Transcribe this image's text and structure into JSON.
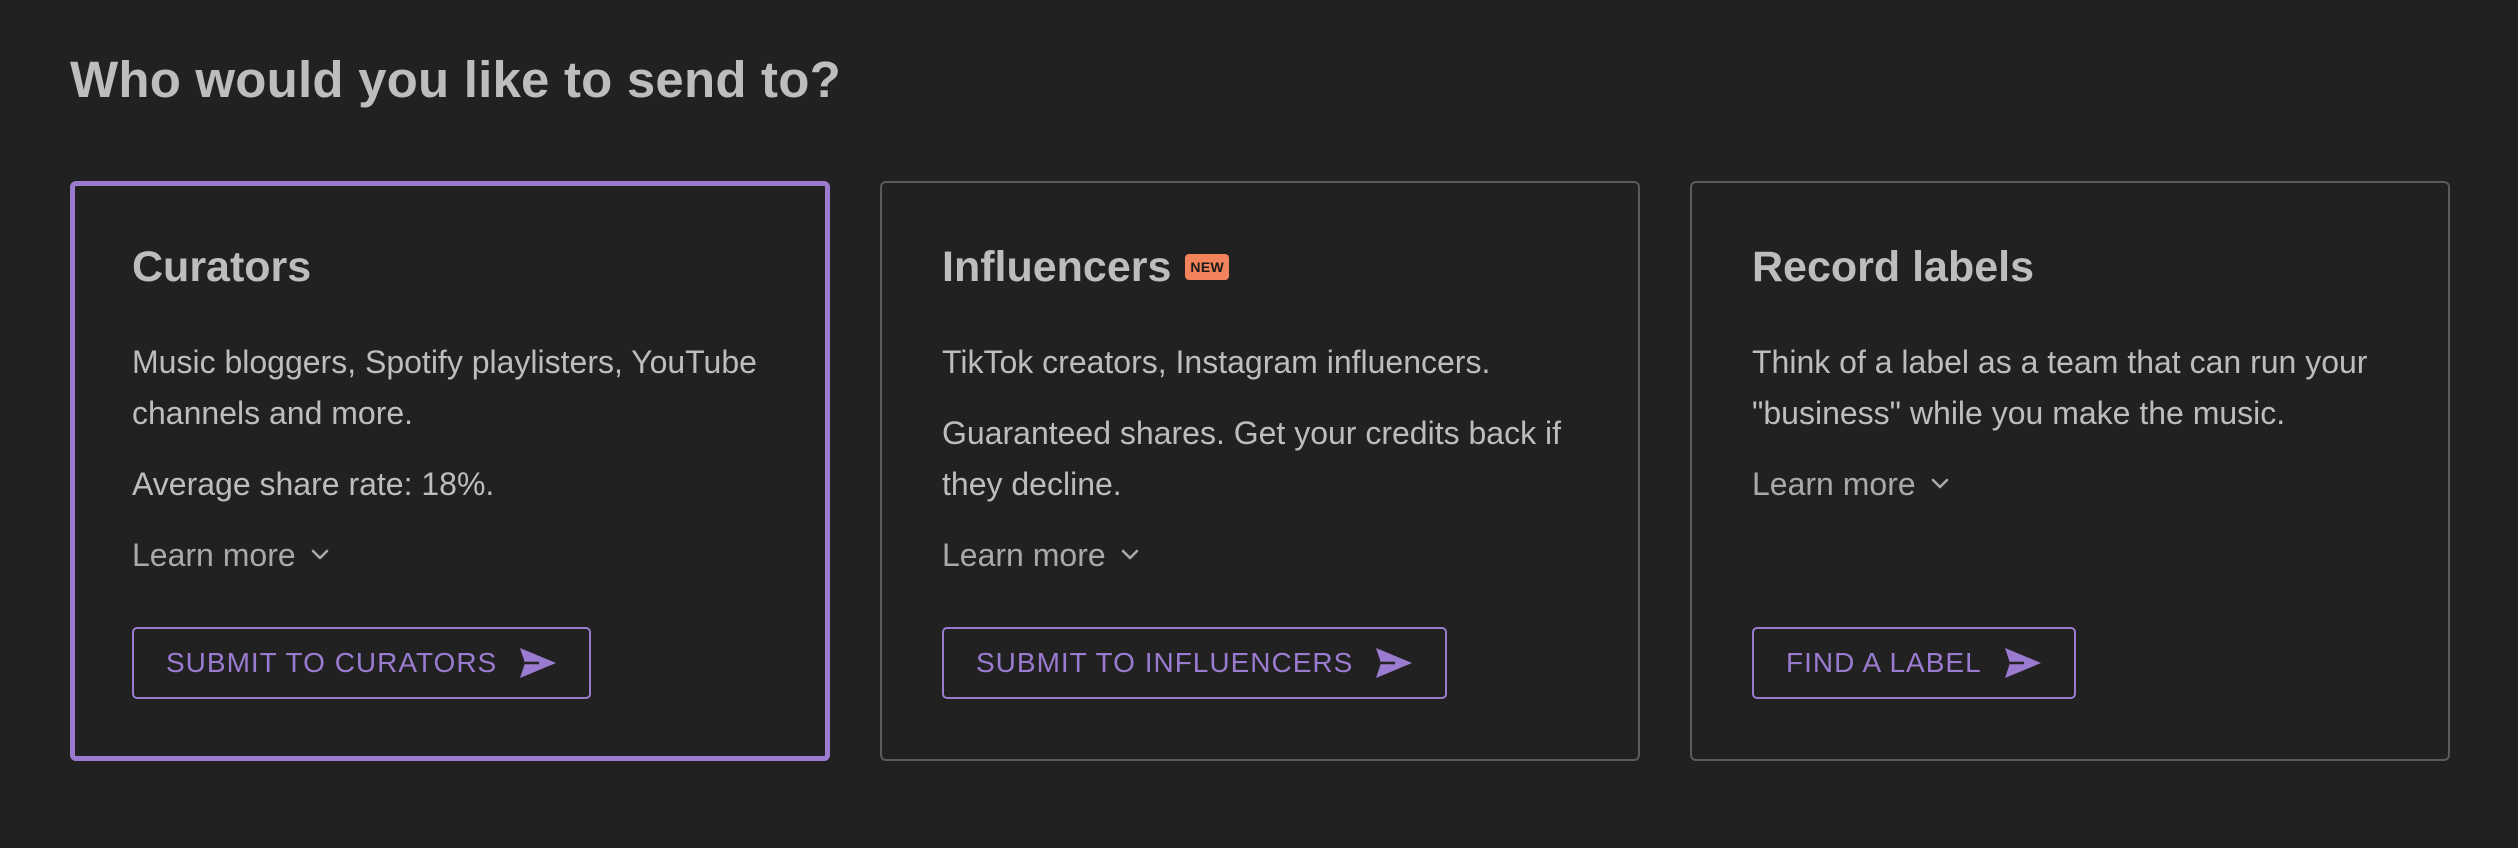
{
  "heading": "Who would you like to send to?",
  "colors": {
    "background": "#212121",
    "accent": "#9b7bd0",
    "badge": "#f2835a",
    "text": "#bdbdbd",
    "border": "#5b5b5b"
  },
  "cards": [
    {
      "title": "Curators",
      "selected": true,
      "paragraphs": [
        "Music bloggers, Spotify playlisters, YouTube channels and more.",
        "Average share rate: 18%."
      ],
      "learn_more": "Learn more",
      "button": "SUBMIT TO CURATORS",
      "button_icon": "send-icon"
    },
    {
      "title": "Influencers",
      "badge": "NEW",
      "selected": false,
      "paragraphs": [
        "TikTok creators, Instagram influencers.",
        "Guaranteed shares. Get your credits back if they decline."
      ],
      "learn_more": "Learn more",
      "button": "SUBMIT TO INFLUENCERS",
      "button_icon": "send-icon"
    },
    {
      "title": "Record labels",
      "selected": false,
      "paragraphs": [
        "Think of a label as a team that can run your \"business\" while you make the music."
      ],
      "learn_more": "Learn more",
      "button": "FIND A LABEL",
      "button_icon": "send-icon"
    }
  ]
}
